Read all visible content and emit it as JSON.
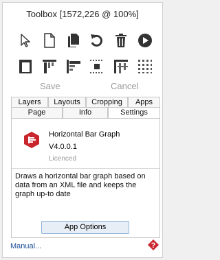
{
  "window": {
    "title": "Toolbox [1572,226 @ 100%]"
  },
  "toolbar": {
    "row1_icons": [
      "pointer-icon",
      "new-page-icon",
      "copy-page-icon",
      "undo-icon",
      "delete-icon",
      "play-icon"
    ],
    "row2_icons": [
      "page-border-icon",
      "align-top-icon",
      "align-left-icon",
      "distribute-icon",
      "align-grid-icon",
      "grid-dots-icon"
    ]
  },
  "actions": {
    "save_label": "Save",
    "cancel_label": "Cancel"
  },
  "tabs": {
    "row1": [
      "Layers",
      "Layouts",
      "Cropping",
      "Apps"
    ],
    "row2": [
      "Page",
      "Info",
      "Settings"
    ],
    "active": "Settings"
  },
  "plugin": {
    "name": "Horizontal Bar Graph",
    "version": "V4.0.0.1",
    "licence": "Licenced",
    "description": "Draws a horizontal bar graph based on data from an XML file and keeps the graph up-to date",
    "icon_color": "#c8252c",
    "options_label": "App Options"
  },
  "footer": {
    "manual_link": "Manual...",
    "help_icon_color": "#c8252c"
  }
}
